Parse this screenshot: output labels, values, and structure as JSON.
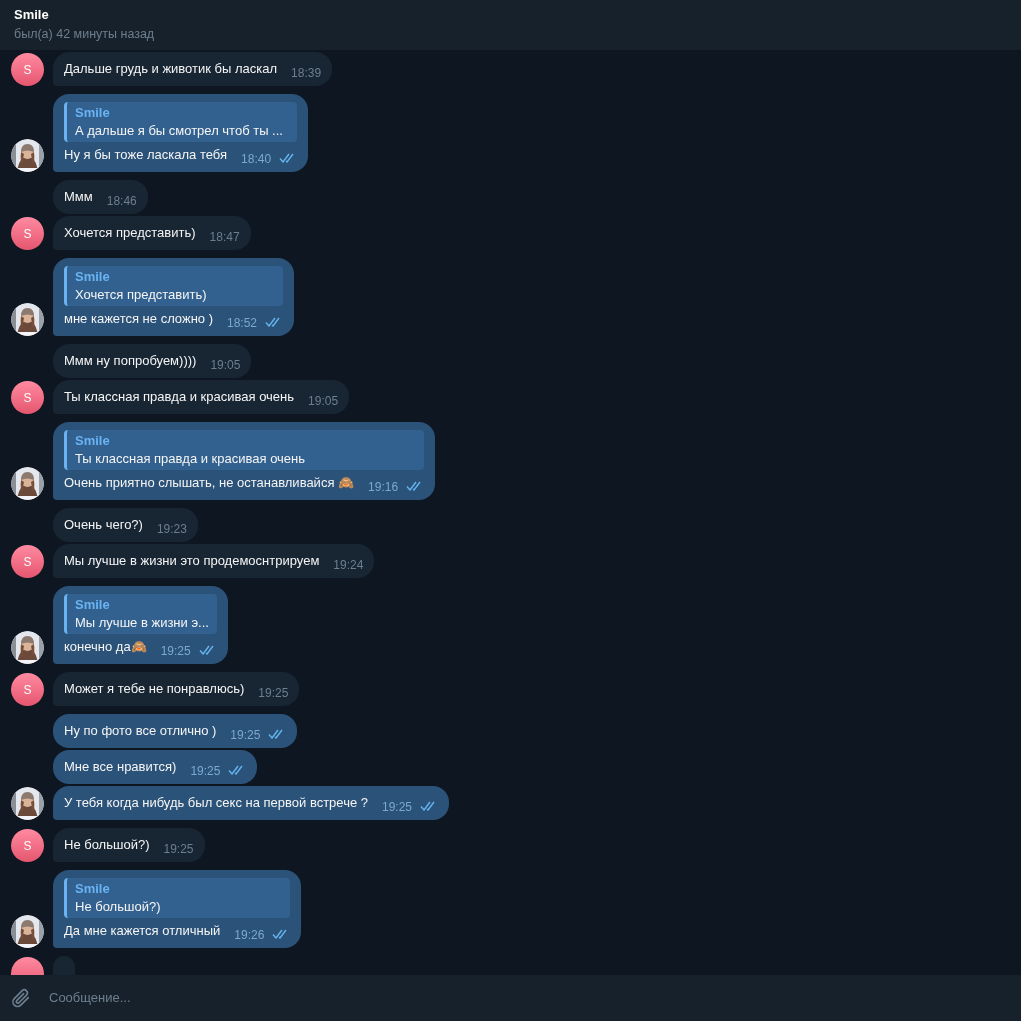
{
  "header": {
    "title": "Smile",
    "status": "был(а) 42 минуты назад"
  },
  "messages": [
    {
      "kind": "incoming",
      "avatar": true,
      "avatar_letter": "S",
      "text": "Дальше грудь и животик бы ласкал",
      "time": "18:39"
    },
    {
      "kind": "outgoing",
      "avatar": true,
      "reply": {
        "name": "Smile",
        "text": "А дальше я бы смотрел чтоб ты ..."
      },
      "text": "Ну я бы тоже ласкала тебя",
      "time": "18:40",
      "read": true
    },
    {
      "kind": "incoming",
      "avatar": false,
      "text": "Ммм",
      "time": "18:46"
    },
    {
      "kind": "incoming",
      "avatar": true,
      "avatar_letter": "S",
      "text": "Хочется представить)",
      "time": "18:47"
    },
    {
      "kind": "outgoing",
      "avatar": true,
      "reply": {
        "name": "Smile",
        "text": "Хочется представить)"
      },
      "text": "мне кажется не сложно )",
      "time": "18:52",
      "read": true
    },
    {
      "kind": "incoming",
      "avatar": false,
      "text": "Ммм ну попробуем))))",
      "time": "19:05"
    },
    {
      "kind": "incoming",
      "avatar": true,
      "avatar_letter": "S",
      "text": "Ты классная правда и красивая очень",
      "time": "19:05"
    },
    {
      "kind": "outgoing",
      "avatar": true,
      "reply": {
        "name": "Smile",
        "text": "Ты классная правда и красивая очень"
      },
      "text": "Очень приятно слышать, не останавливайся 🙈",
      "time": "19:16",
      "read": true
    },
    {
      "kind": "incoming",
      "avatar": false,
      "text": "Очень чего?)",
      "time": "19:23"
    },
    {
      "kind": "incoming",
      "avatar": true,
      "avatar_letter": "S",
      "text": "Мы лучше в жизни это продемоснтрируем",
      "time": "19:24"
    },
    {
      "kind": "outgoing",
      "avatar": true,
      "reply": {
        "name": "Smile",
        "text": "Мы лучше в жизни э..."
      },
      "text": "конечно да🙈",
      "time": "19:25",
      "read": true
    },
    {
      "kind": "incoming",
      "avatar": true,
      "avatar_letter": "S",
      "text": "Может я тебе не понравлюсь)",
      "time": "19:25"
    },
    {
      "kind": "outgoing",
      "avatar": false,
      "text": "Ну по фото все отлично )",
      "time": "19:25",
      "read": true
    },
    {
      "kind": "outgoing",
      "avatar": false,
      "text": "Мне все нравится)",
      "time": "19:25",
      "read": true
    },
    {
      "kind": "outgoing",
      "avatar": true,
      "text": "У тебя когда нибудь был секс на первой встрече ?",
      "time": "19:25",
      "read": true
    },
    {
      "kind": "incoming",
      "avatar": true,
      "avatar_letter": "S",
      "text": "Не большой?)",
      "time": "19:25"
    },
    {
      "kind": "outgoing",
      "avatar": true,
      "reply": {
        "name": "Smile",
        "text": "Не большой?)"
      },
      "text": "Да мне кажется отличный",
      "time": "19:26",
      "read": true
    },
    {
      "kind": "incoming",
      "avatar": true
    }
  ],
  "composer": {
    "placeholder": "Сообщение..."
  }
}
